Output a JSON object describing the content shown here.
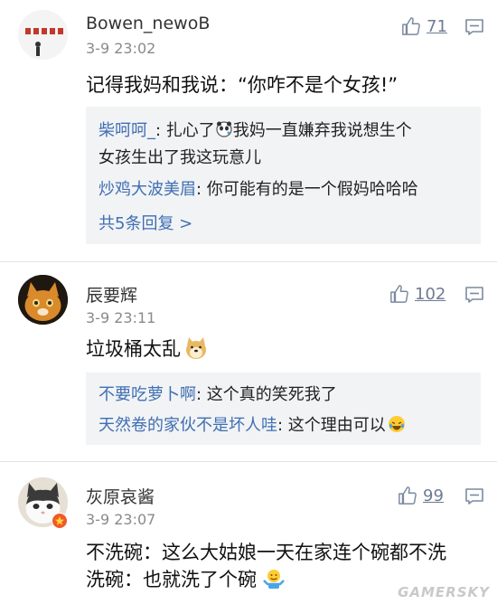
{
  "comments": [
    {
      "username": "Bowen_newoB",
      "time": "3-9 23:02",
      "likes": "71",
      "text": "记得我妈和我说：“你咋不是个女孩!”",
      "replies": [
        {
          "name": "柴呵呵_",
          "sep": ": ",
          "text": "扎心了",
          "text2": "我妈一直嫌弃我说想生个",
          "text3": "女孩生出了我这玩意儿"
        },
        {
          "name": "炒鸡大波美眉",
          "sep": ": ",
          "text": "你可能有的是一个假妈哈哈哈"
        }
      ],
      "more": "共5条回复 >"
    },
    {
      "username": "辰要辉",
      "time": "3-9 23:11",
      "likes": "102",
      "text": "垃圾桶太乱",
      "replies": [
        {
          "name": "不要吃萝卜啊",
          "sep": ": ",
          "text": "这个真的笑死我了"
        },
        {
          "name": "天然卷的家伙不是坏人哇",
          "sep": ": ",
          "text": "这个理由可以"
        }
      ]
    },
    {
      "username": "灰原哀酱",
      "time": "3-9 23:07",
      "likes": "99",
      "text": "不洗碗：这么大姑娘一天在家连个碗都不洗",
      "text2": "洗碗：也就洗了个碗"
    }
  ],
  "watermark": "GAMERSKY",
  "colors": {
    "link": "#3f6fb3",
    "reply_bg": "#f2f3f5",
    "time": "#8a8a8a"
  }
}
